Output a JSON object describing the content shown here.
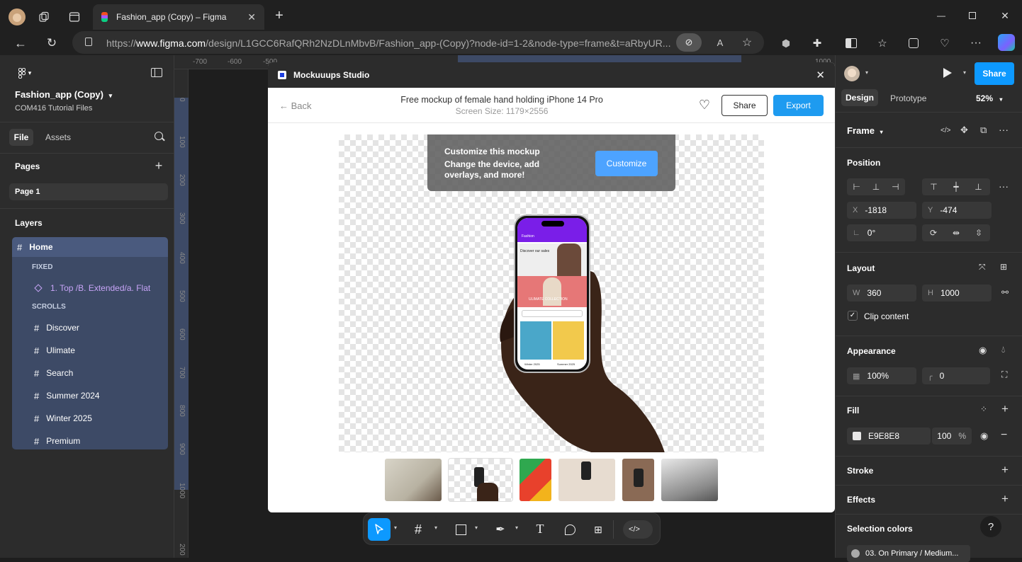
{
  "browser": {
    "tab_title": "Fashion_app (Copy) – Figma",
    "url_prefix": "https://",
    "url_domain": "www.figma.com",
    "url_path": "/design/L1GCC6RafQRh2NzDLnMbvB/Fashion_app-(Copy)?node-id=1-2&node-type=frame&t=aRbyUR..."
  },
  "file": {
    "name": "Fashion_app (Copy)",
    "team": "COM416 Tutorial Files",
    "tabs": [
      "File",
      "Assets"
    ]
  },
  "pages": {
    "heading": "Pages",
    "items": [
      "Page 1"
    ]
  },
  "layers": {
    "heading": "Layers",
    "root": "Home",
    "fixed_label": "FIXED",
    "fixed_item": "1. Top /B. Extended/a. Flat",
    "scrolls_label": "SCROLLS",
    "scroll_items": [
      "Discover",
      "Ulimate",
      "Search",
      "Summer 2024",
      "Winter 2025",
      "Premium"
    ]
  },
  "rulers": {
    "top": [
      "-700",
      "-600",
      "-500"
    ],
    "top_right": [
      "1000"
    ],
    "left": [
      "0",
      "100",
      "200",
      "300",
      "400",
      "500",
      "600",
      "700",
      "800",
      "900",
      "1000",
      "200"
    ]
  },
  "modal": {
    "app_name": "Mockuuups Studio",
    "back_label": "Back",
    "title": "Free mockup of female hand holding iPhone 14 Pro",
    "subtitle": "Screen Size: 1179×2556",
    "share_label": "Share",
    "export_label": "Export",
    "banner_title": "Customize this mockup",
    "banner_text": "Change the device, add overlays, and more!",
    "customize_label": "Customize",
    "phone": {
      "app_title": "Fashion",
      "discover_text": "Discover our sales",
      "ultimate_text": "ULIMATE COLLECTION",
      "card1": "Winter 2025",
      "card2": "Summer 2025"
    }
  },
  "right_panel": {
    "share_label": "Share",
    "tabs": [
      "Design",
      "Prototype"
    ],
    "zoom": "52%",
    "frame_label": "Frame",
    "position_label": "Position",
    "x_key": "X",
    "x_value": "-1818",
    "y_key": "Y",
    "y_value": "-474",
    "rotation_value": "0°",
    "layout_label": "Layout",
    "w_key": "W",
    "w_value": "360",
    "h_key": "H",
    "h_value": "1000",
    "clip_label": "Clip content",
    "appearance_label": "Appearance",
    "opacity_value": "100%",
    "radius_value": "0",
    "fill_label": "Fill",
    "fill_hex": "E9E8E8",
    "fill_opacity": "100",
    "fill_pct": "%",
    "stroke_label": "Stroke",
    "effects_label": "Effects",
    "selection_colors_label": "Selection colors",
    "selection_color_1": "03. On Primary / Medium..."
  },
  "colors": {
    "accent": "#0d99ff",
    "layer_selected": "#3d4a66",
    "export_blue": "#1e9bf0",
    "phone_purple": "#7a1ee8"
  }
}
